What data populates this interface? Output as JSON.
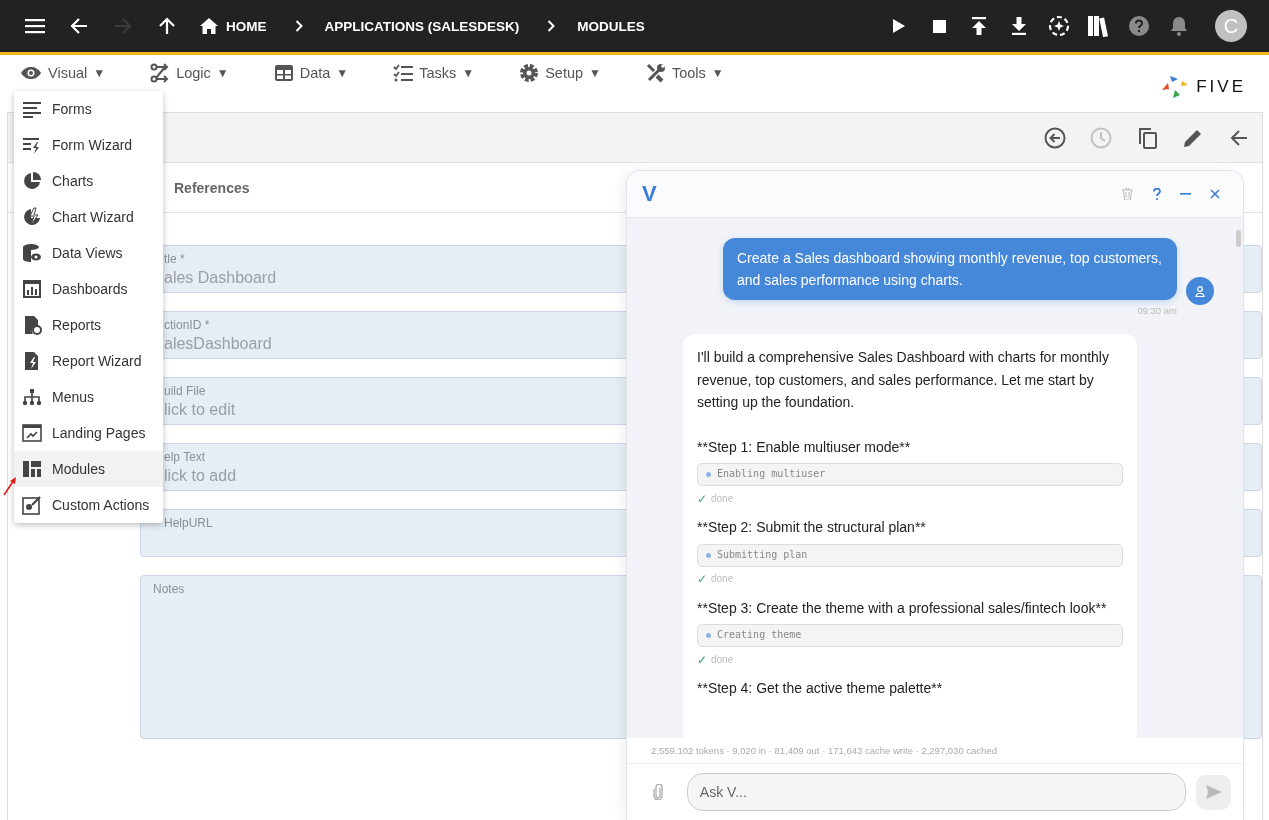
{
  "topbar": {
    "nav": [
      {
        "kind": "menu",
        "disabled": false
      },
      {
        "kind": "back",
        "disabled": false
      },
      {
        "kind": "forward",
        "disabled": true
      },
      {
        "kind": "up",
        "disabled": false
      }
    ],
    "breadcrumbs": [
      "HOME",
      "APPLICATIONS (SALESDESK)",
      "MODULES"
    ],
    "actions": [
      {
        "kind": "play"
      },
      {
        "kind": "stop"
      },
      {
        "kind": "upload"
      },
      {
        "kind": "download"
      },
      {
        "kind": "ai"
      },
      {
        "kind": "library"
      },
      {
        "kind": "help"
      },
      {
        "kind": "bell"
      }
    ],
    "avatar": "C"
  },
  "menubar": [
    {
      "kind": "visual",
      "label": "Visual",
      "caret": "▼"
    },
    {
      "kind": "logic",
      "label": "Logic",
      "caret": "▼"
    },
    {
      "kind": "data",
      "label": "Data",
      "caret": "▼"
    },
    {
      "kind": "tasks",
      "label": "Tasks",
      "caret": "▼"
    },
    {
      "kind": "setup",
      "label": "Setup",
      "caret": "▼"
    },
    {
      "kind": "tools",
      "label": "Tools",
      "caret": "▼"
    }
  ],
  "logo_text": "FIVE",
  "dropdown": [
    {
      "label": "Forms",
      "selected": false
    },
    {
      "label": "Form Wizard",
      "selected": false
    },
    {
      "label": "Charts",
      "selected": false
    },
    {
      "label": "Chart Wizard",
      "selected": false
    },
    {
      "label": "Data Views",
      "selected": false
    },
    {
      "label": "Dashboards",
      "selected": false
    },
    {
      "label": "Reports",
      "selected": false
    },
    {
      "label": "Report Wizard",
      "selected": false
    },
    {
      "label": "Menus",
      "selected": false
    },
    {
      "label": "Landing Pages",
      "selected": false
    },
    {
      "label": "Modules",
      "selected": true
    },
    {
      "label": "Custom Actions",
      "selected": false
    }
  ],
  "toolbar": [
    {
      "kind": "back-circle",
      "disabled": false
    },
    {
      "kind": "history",
      "disabled": true
    },
    {
      "kind": "copy",
      "disabled": false
    },
    {
      "kind": "edit",
      "disabled": false
    },
    {
      "kind": "back",
      "disabled": false
    }
  ],
  "tabs": [
    {
      "label": "References"
    }
  ],
  "fields": [
    {
      "kind": "text",
      "label": "tle *",
      "value": "ales Dashboard"
    },
    {
      "kind": "text",
      "label": "ctionID *",
      "value": "alesDashboard"
    },
    {
      "kind": "text",
      "label": "uild File",
      "value": "lick to edit"
    },
    {
      "kind": "text",
      "label": "elp Text",
      "value": "lick to add"
    },
    {
      "kind": "text",
      "label": "HelpURL"
    },
    {
      "kind": "textarea",
      "label": "Notes"
    }
  ],
  "chat": {
    "logo": "V",
    "header_buttons": [
      {
        "kind": "delete"
      },
      {
        "kind": "help"
      },
      {
        "kind": "minimize"
      },
      {
        "kind": "close"
      }
    ],
    "user_message": {
      "text": "Create a Sales dashboard showing monthly revenue, top customers, and sales performance using charts.",
      "time": "09:30 am"
    },
    "assistant_message": {
      "intro": "I'll build a comprehensive Sales Dashboard with charts for monthly revenue, top customers, and sales performance. Let me start by setting up the foundation.",
      "steps": [
        {
          "title": "**Step 1: Enable multiuser mode**",
          "tool": "Enabling multiuser",
          "mark": "✓",
          "status": "done"
        },
        {
          "title": "**Step 2: Submit the structural plan**",
          "tool": "Submitting plan",
          "mark": "✓",
          "status": "done"
        },
        {
          "title": "**Step 3: Create the theme with a professional sales/fintech look**",
          "tool": "Creating theme",
          "mark": "✓",
          "status": "done"
        },
        {
          "title": "**Step 4: Get the active theme palette**"
        }
      ]
    },
    "usage": "2,559,102 tokens · 9,020 in · 81,409 out · 171,643 cache write · 2,297,030 cached",
    "input": {
      "placeholder": "Ask V..."
    }
  }
}
